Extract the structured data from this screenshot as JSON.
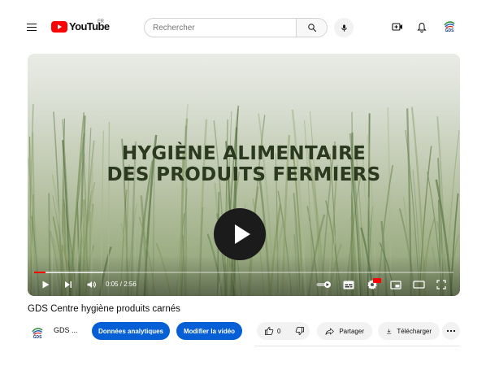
{
  "masthead": {
    "logo_text": "YouTube",
    "region": "FR",
    "search_placeholder": "Rechercher",
    "avatar_text": "GDS"
  },
  "player": {
    "title_line1": "HYGIÈNE ALIMENTAIRE",
    "title_line2": "DES PRODUITS FERMIERS",
    "time": "0:05 / 2:56",
    "progress_fraction": 0.028,
    "buffer_fraction": 0.165,
    "settings_badge": "HD",
    "accent": "#ff0000"
  },
  "video": {
    "heading": "GDS Centre hygiène produits carnés",
    "channel_name": "GDS ...",
    "channel_avatar_text": "GDS",
    "analytics_label": "Données analytiques",
    "edit_label": "Modifier la vidéo",
    "like_count": "0",
    "share_label": "Partager",
    "download_label": "Télécharger",
    "button_color": "#065fd4"
  },
  "icons": [
    "menu-icon",
    "search-icon",
    "mic-icon",
    "create-icon",
    "bell-icon",
    "play-icon",
    "next-icon",
    "volume-icon",
    "autoplay-icon",
    "subtitles-icon",
    "settings-icon",
    "miniplayer-icon",
    "theater-icon",
    "fullscreen-icon",
    "like-icon",
    "dislike-icon",
    "share-icon",
    "download-icon",
    "more-icon"
  ]
}
